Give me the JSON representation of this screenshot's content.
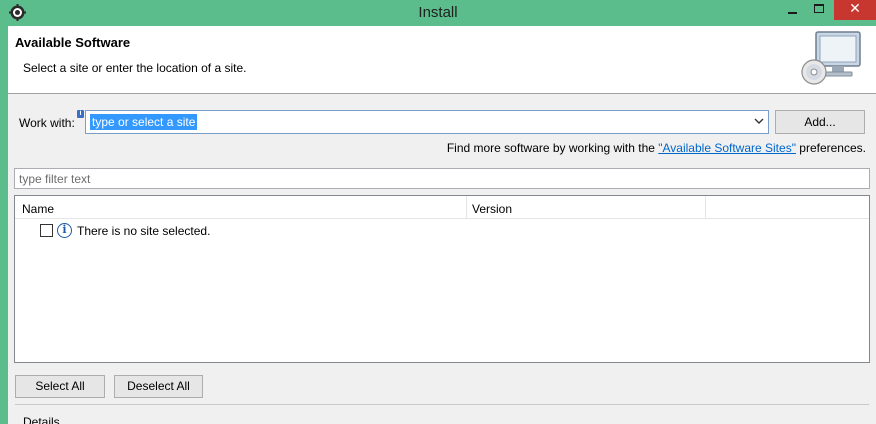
{
  "window": {
    "title": "Install",
    "app_icon": "eclipse-gear-icon",
    "close_label": "✕",
    "accent": "#5bbd8b",
    "close_color": "#c7372f"
  },
  "header": {
    "title": "Available Software",
    "description": "Select a site or enter the location of a site.",
    "graphic": "install-monitor-cd-icon"
  },
  "work_with": {
    "label": "Work with:",
    "value": "type or select a site",
    "add_label": "Add..."
  },
  "find_more": {
    "prefix": "Find more software by working with the ",
    "link": "\"Available Software Sites\"",
    "suffix": " preferences."
  },
  "filter": {
    "placeholder": "type filter text"
  },
  "table": {
    "columns": [
      "Name",
      "Version"
    ],
    "rows": [
      {
        "name": "There is no site selected.",
        "version": "",
        "checked": false,
        "icon": "info-icon"
      }
    ]
  },
  "buttons": {
    "select_all": "Select All",
    "deselect_all": "Deselect All"
  },
  "details": {
    "label": "Details"
  }
}
